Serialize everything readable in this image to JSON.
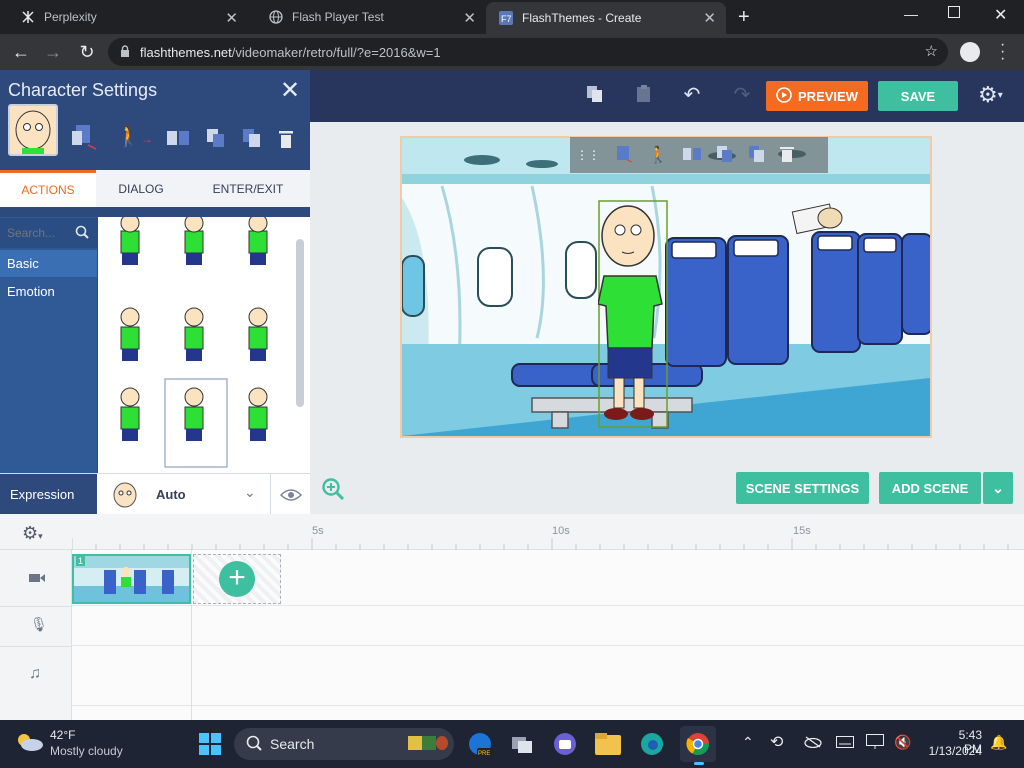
{
  "browser": {
    "tabs": [
      {
        "title": "Perplexity"
      },
      {
        "title": "Flash Player Test"
      },
      {
        "title": "FlashThemes - Create"
      }
    ],
    "url_host": "flashthemes.net",
    "url_path": "/videomaker/retro/full/?e=2016&w=1"
  },
  "toolbar": {
    "preview_label": "PREVIEW",
    "save_label": "SAVE"
  },
  "panel": {
    "title": "Character Settings",
    "tabs": [
      "ACTIONS",
      "DIALOG",
      "ENTER/EXIT"
    ],
    "search_placeholder": "Search...",
    "categories": [
      "Basic",
      "Emotion"
    ],
    "expression_label": "Expression",
    "expression_value": "Auto"
  },
  "scene": {
    "settings_label": "SCENE SETTINGS",
    "add_label": "ADD SCENE"
  },
  "timeline": {
    "ticks": [
      "5s",
      "10s",
      "15s"
    ],
    "scene_number": "1"
  },
  "taskbar": {
    "weather_temp": "42°F",
    "weather_desc": "Mostly cloudy",
    "search_label": "Search",
    "time": "5:43 PM",
    "date": "1/13/2024"
  },
  "colors": {
    "accent_orange": "#f26b21",
    "accent_teal": "#3ebf9f",
    "panel_blue": "#2e4a7c",
    "app_bar": "#28355c"
  }
}
